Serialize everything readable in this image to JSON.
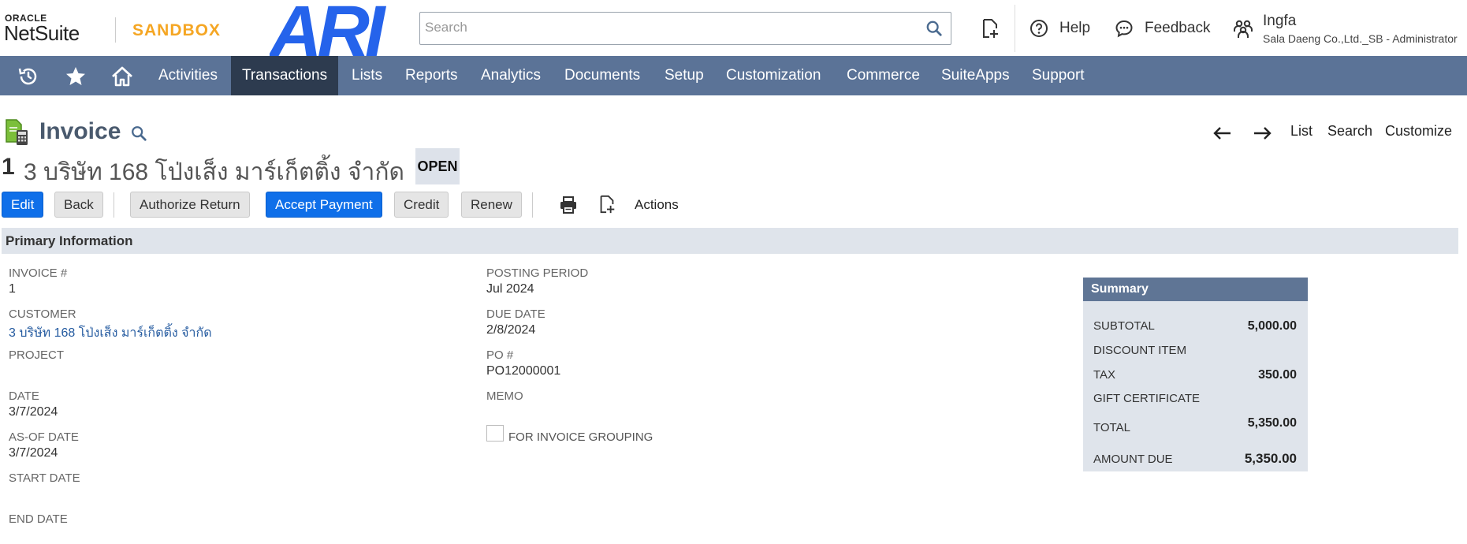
{
  "header": {
    "logo_oracle": "ORACLE",
    "logo_netsuite": "NetSuite",
    "environment": "SANDBOX",
    "brand": "ARI",
    "search_placeholder": "Search",
    "help_label": "Help",
    "feedback_label": "Feedback",
    "user_name": "Ingfa",
    "user_role": "Sala Daeng Co.,Ltd._SB - Administrator"
  },
  "nav": {
    "items": [
      "Activities",
      "Transactions",
      "Lists",
      "Reports",
      "Analytics",
      "Documents",
      "Setup",
      "Customization",
      "Commerce",
      "SuiteApps",
      "Support"
    ],
    "active": "Transactions"
  },
  "page": {
    "title": "Invoice",
    "pager": {
      "list": "List",
      "search": "Search",
      "customize": "Customize"
    },
    "record_number": "1",
    "record_name": "3 บริษัท 168 โป่งเส็ง มาร์เก็ตติ้ง จำกัด",
    "status": "OPEN"
  },
  "buttons": {
    "edit": "Edit",
    "back": "Back",
    "authorize_return": "Authorize Return",
    "accept_payment": "Accept Payment",
    "credit": "Credit",
    "renew": "Renew",
    "actions": "Actions"
  },
  "section": {
    "title": "Primary Information"
  },
  "fields": {
    "invoice_label": "INVOICE #",
    "invoice_value": "1",
    "customer_label": "CUSTOMER",
    "customer_value": "3 บริษัท 168 โป่งเส็ง มาร์เก็ตติ้ง จำกัด",
    "project_label": "PROJECT",
    "date_label": "DATE",
    "date_value": "3/7/2024",
    "asof_label": "AS-OF DATE",
    "asof_value": "3/7/2024",
    "start_label": "START DATE",
    "end_label": "END DATE",
    "posting_label": "POSTING PERIOD",
    "posting_value": "Jul 2024",
    "due_label": "DUE DATE",
    "due_value": "2/8/2024",
    "po_label": "PO #",
    "po_value": "PO12000001",
    "memo_label": "MEMO",
    "grouping_label": "FOR INVOICE GROUPING"
  },
  "summary": {
    "title": "Summary",
    "subtotal_label": "SUBTOTAL",
    "subtotal_value": "5,000.00",
    "discount_label": "DISCOUNT ITEM",
    "tax_label": "TAX",
    "tax_value": "350.00",
    "gift_label": "GIFT CERTIFICATE",
    "total_label": "TOTAL",
    "total_value": "5,350.00",
    "amount_due_label": "AMOUNT DUE",
    "amount_due_value": "5,350.00"
  },
  "colors": {
    "nav_bg": "#5b7397",
    "nav_active": "#2d3b4f",
    "primary_button": "#0f6fe9",
    "sandbox_orange": "#f5a623",
    "brand_blue": "#2563eb",
    "link": "#255ba0"
  },
  "icons": [
    "search-icon",
    "new-record-icon",
    "help-icon",
    "feedback-icon",
    "roles-icon",
    "recent-icon",
    "star-icon",
    "home-icon",
    "invoice-icon",
    "arrow-left-icon",
    "arrow-right-icon",
    "print-icon"
  ]
}
